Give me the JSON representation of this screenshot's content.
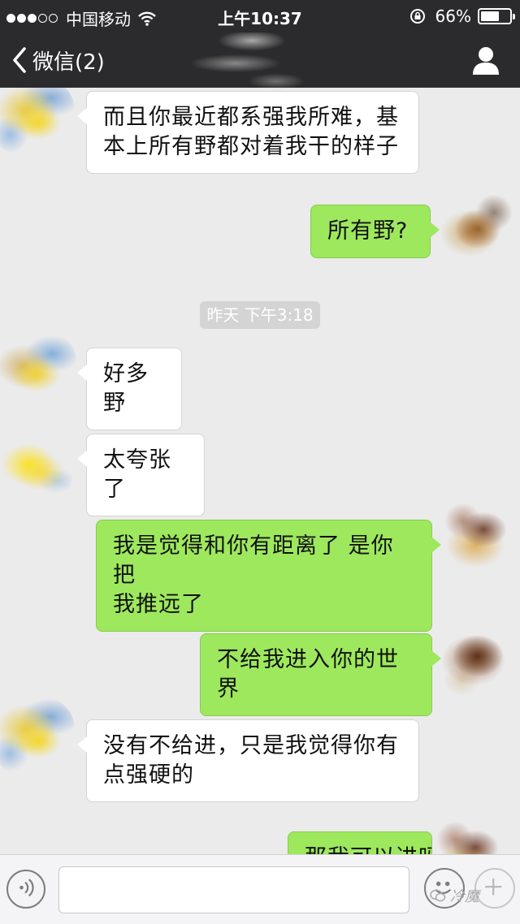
{
  "status_bar": {
    "carrier": "中国移动",
    "time": "上午10:37",
    "battery_percent": "66%",
    "battery_level": 0.66,
    "signal_bars_filled": 3,
    "signal_bars_total": 5
  },
  "nav": {
    "back_label": "微信(2)",
    "back_icon": "chevron-left-icon",
    "profile_icon": "person-icon"
  },
  "chat": {
    "timestamp": "昨天 下午3:18",
    "messages": [
      {
        "side": "left",
        "lines": [
          "而且你最近都系强我所难，基",
          "本上所有野都对着我干的样子"
        ]
      },
      {
        "side": "right",
        "lines": [
          "所有野?"
        ]
      },
      {
        "side": "left",
        "lines": [
          "好多野"
        ]
      },
      {
        "side": "left",
        "lines": [
          "太夸张了"
        ]
      },
      {
        "side": "right",
        "lines": [
          "我是觉得和你有距离了 是你把",
          "我推远了"
        ]
      },
      {
        "side": "right",
        "lines": [
          "不给我进入你的世界"
        ]
      },
      {
        "side": "left",
        "lines": [
          "没有不给进，只是我觉得你有",
          "点强硬的"
        ]
      },
      {
        "side": "right",
        "lines": [
          "那我可以进吗"
        ]
      }
    ]
  },
  "input_bar": {
    "voice_icon": "voice-icon",
    "emoji_icon": "emoji-icon",
    "more_icon": "plus-icon",
    "input_value": ""
  },
  "watermark": {
    "text": "冷魔"
  },
  "colors": {
    "header_bg": "#2b2b2d",
    "chat_bg": "#ebebeb",
    "bubble_green": "#9ee85e",
    "bubble_white": "#ffffff"
  }
}
